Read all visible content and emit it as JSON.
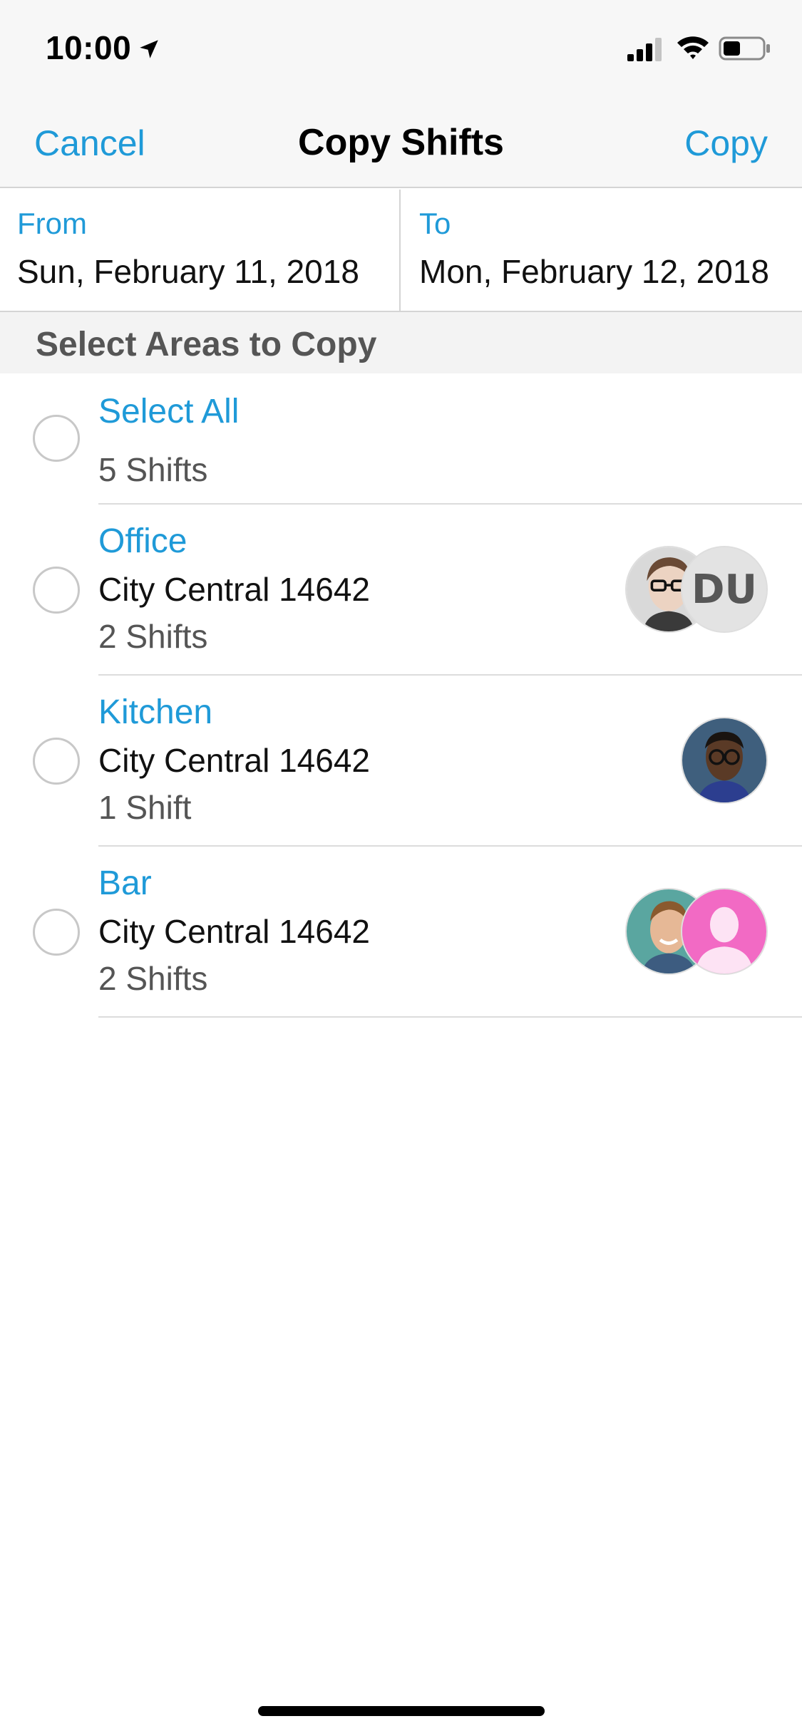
{
  "status_bar": {
    "time": "10:00",
    "icons": [
      "location-arrow-icon",
      "cellular-signal-icon",
      "wifi-icon",
      "battery-icon"
    ],
    "battery_level": 0.45
  },
  "nav": {
    "cancel_label": "Cancel",
    "title": "Copy Shifts",
    "copy_label": "Copy"
  },
  "dates": {
    "from_label": "From",
    "from_value": "Sun, February 11, 2018",
    "to_label": "To",
    "to_value": "Mon, February 12, 2018"
  },
  "section": {
    "title": "Select Areas to Copy"
  },
  "select_all": {
    "label": "Select All",
    "count": "5 Shifts",
    "selected": false
  },
  "areas": [
    {
      "name": "Office",
      "location": "City Central 14642",
      "count": "2 Shifts",
      "selected": false,
      "avatars": [
        "avatar-woman-glasses",
        "DU"
      ]
    },
    {
      "name": "Kitchen",
      "location": "City Central 14642",
      "count": "1 Shift",
      "selected": false,
      "avatars": [
        "avatar-man-glasses"
      ]
    },
    {
      "name": "Bar",
      "location": "City Central 14642",
      "count": "2 Shifts",
      "selected": false,
      "avatars": [
        "avatar-man-smiling",
        "avatar-placeholder-pink"
      ]
    }
  ],
  "colors": {
    "accent": "#1f9ad8",
    "bar_background": "#f7f7f7",
    "placeholder_avatar": "#f26ac4"
  }
}
